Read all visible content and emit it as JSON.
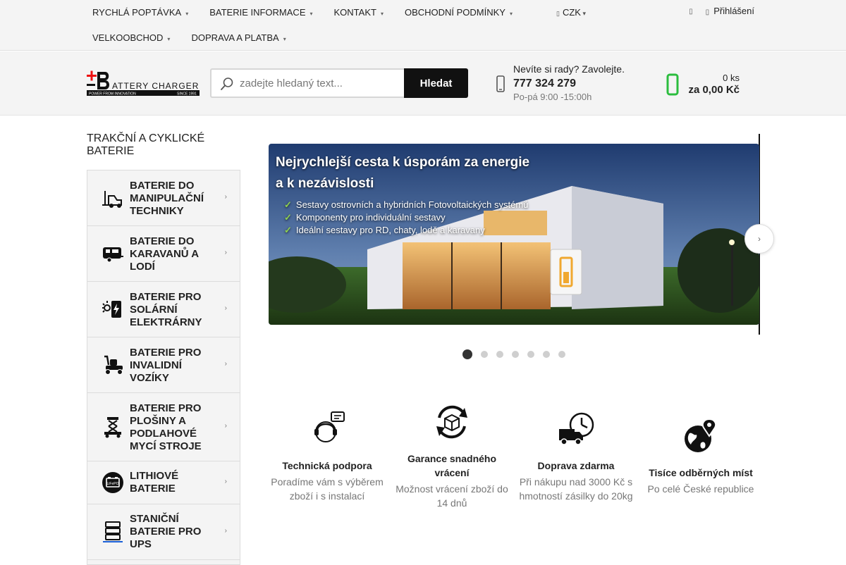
{
  "topnav": {
    "items": [
      {
        "label": "RYCHLÁ POPTÁVKA"
      },
      {
        "label": "BATERIE INFORMACE"
      },
      {
        "label": "KONTAKT"
      },
      {
        "label": "OBCHODNÍ PODMÍNKY"
      },
      {
        "label": "VELKOOBCHOD"
      },
      {
        "label": "DOPRAVA A PLATBA"
      }
    ],
    "currency": "CZK",
    "login_label": "Přihlášení"
  },
  "header": {
    "search_placeholder": "zadejte hledaný text...",
    "search_button": "Hledat",
    "phone_question": "Nevíte si rady? Zavolejte.",
    "phone_number": "777 324 279",
    "phone_hours": "Po-pá 9:00 -15:00h",
    "cart_qty": "0 ks",
    "cart_total": "za 0,00 Kč"
  },
  "logo": {
    "text": "BATTERY CHARGER CZ",
    "tagline": "POWER FROM INNOVATION",
    "since": "SINCE 1991"
  },
  "sidebar": {
    "title": "TRAKČNÍ A CYKLICKÉ BATERIE",
    "items": [
      {
        "label": "BATERIE DO MANIPULAČNÍ TECHNIKY",
        "icon": "forklift-icon"
      },
      {
        "label": "BATERIE DO KARAVANŮ A LODÍ",
        "icon": "caravan-icon"
      },
      {
        "label": "BATERIE PRO SOLÁRNÍ ELEKTRÁRNY",
        "icon": "solar-battery-icon"
      },
      {
        "label": "BATERIE PRO INVALIDNÍ VOZÍKY",
        "icon": "mobility-scooter-icon"
      },
      {
        "label": "BATERIE PRO PLOŠINY A PODLAHOVÉ MYCÍ STROJE",
        "icon": "scissor-lift-icon"
      },
      {
        "label": "LITHIOVÉ BATERIE",
        "icon": "lithium-battery-icon"
      },
      {
        "label": "STANIČNÍ BATERIE PRO UPS",
        "icon": "ups-rack-icon"
      }
    ]
  },
  "slider": {
    "headline_1": "Nejrychlejší cesta k úsporám za energie",
    "headline_2": "a k nezávislosti",
    "bullets": [
      "Sestavy ostrovních a hybridních Fotovoltaických systémů",
      "Komponenty pro individuální sestavy",
      "Ideální sestavy pro RD, chaty, lodě a karavany"
    ],
    "dot_count": 7,
    "active_dot": 0
  },
  "features": [
    {
      "title": "Technická podpora",
      "desc": "Poradíme vám s výběrem zboží i s instalací",
      "icon": "support-headset-icon"
    },
    {
      "title": "Garance snadného vrácení",
      "desc": "Možnost vrácení zboží do 14 dnů",
      "icon": "return-box-icon"
    },
    {
      "title": "Doprava zdarma",
      "desc": "Při nákupu nad 3000 Kč s hmotností zásilky do 20kg",
      "icon": "delivery-truck-icon"
    },
    {
      "title": "Tisíce odběrných míst",
      "desc": "Po celé České republice",
      "icon": "globe-pin-icon"
    }
  ],
  "colors": {
    "accent_green": "#2bbd3e",
    "dark": "#111111",
    "bar_bg": "#f4f4f4"
  }
}
